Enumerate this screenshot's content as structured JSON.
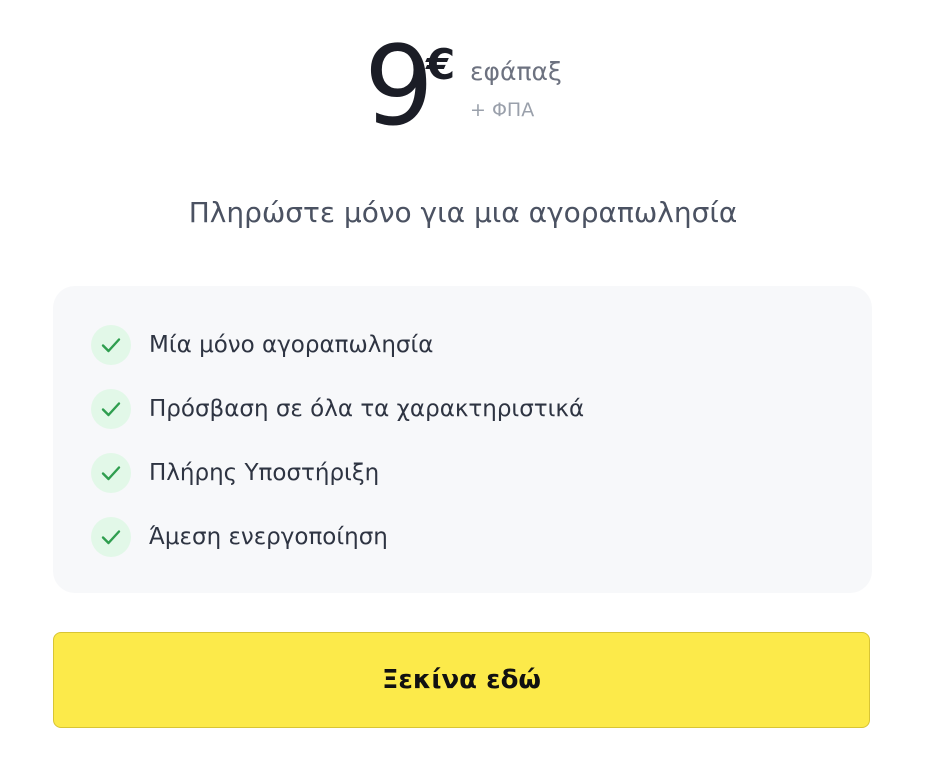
{
  "price": {
    "amount": "9",
    "currency": "€",
    "period": "εφάπαξ",
    "tax_note": "+ ΦΠΑ"
  },
  "subtitle": "Πληρώστε μόνο για μια αγοραπωλησία",
  "features": [
    {
      "label": "Μία μόνο αγοραπωλησία",
      "icon": "check-icon"
    },
    {
      "label": "Πρόσβαση σε όλα τα χαρακτηριστικά",
      "icon": "check-icon"
    },
    {
      "label": "Πλήρης Υποστήριξη",
      "icon": "check-icon"
    },
    {
      "label": "Άμεση ενεργοποίηση",
      "icon": "check-icon"
    }
  ],
  "cta": {
    "label": "Ξεκίνα εδώ"
  },
  "colors": {
    "accent": "#fcea4a",
    "check_bg": "#e2f8e8",
    "check_mark": "#2f9e4f",
    "panel_bg": "#f7f8fa"
  }
}
